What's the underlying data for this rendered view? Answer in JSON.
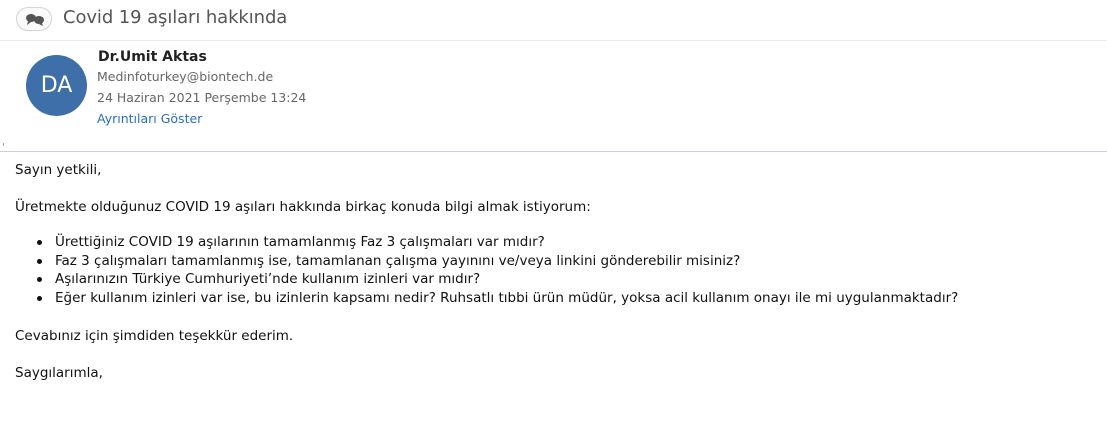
{
  "header": {
    "subject": "Covid 19 aşıları hakkında",
    "avatar_initials": "DA",
    "avatar_color": "#3e6fa8",
    "sender_name": "Dr.Umit Aktas",
    "sender_email": "Medinfoturkey@biontech.de",
    "date": "24 Haziran 2021 Perşembe 13:24",
    "details_link": "Ayrıntıları Göster",
    "link_color": "#2a6ebb"
  },
  "message": {
    "greeting": "Sayın yetkili,",
    "intro": "Üretmekte olduğunuz COVID 19 aşıları hakkında birkaç konuda bilgi almak istiyorum:",
    "questions": [
      "Ürettiğiniz COVID 19 aşılarının tamamlanmış Faz 3 çalışmaları var mıdır?",
      "Faz 3 çalışmaları tamamlanmış ise, tamamlanan çalışma yayınını ve/veya linkini gönderebilir misiniz?",
      "Aşılarınızın Türkiye Cumhuriyeti’nde kullanım izinleri var mıdır?",
      "Eğer kullanım izinleri var ise, bu izinlerin kapsamı nedir? Ruhsatlı tıbbi ürün müdür, yoksa acil kullanım onayı ile mi uygulanmaktadır?"
    ],
    "thanks": "Cevabınız için şimdiden teşekkür ederim.",
    "closing": "Saygılarımla,"
  },
  "icons": {
    "thread": "conversation-icon"
  }
}
